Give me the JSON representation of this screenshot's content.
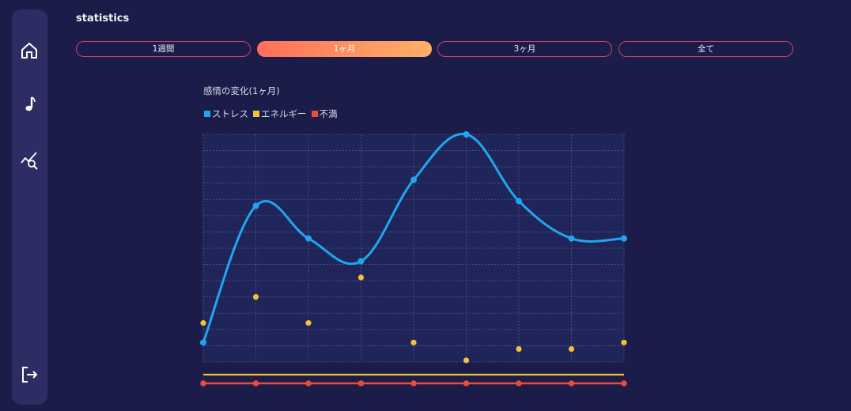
{
  "page": {
    "title": "statistics"
  },
  "sidebar": {
    "items": [
      {
        "icon": "home-icon"
      },
      {
        "icon": "music-note-icon"
      },
      {
        "icon": "chart-search-icon"
      },
      {
        "icon": "logout-icon"
      }
    ]
  },
  "tabs": [
    {
      "label": "1週間",
      "active": false
    },
    {
      "label": "1ヶ月",
      "active": true
    },
    {
      "label": "3ヶ月",
      "active": false
    },
    {
      "label": "全て",
      "active": false
    }
  ],
  "colors": {
    "background": "#1b1c4a",
    "sidebar": "#2d2d63",
    "stress": "#1ea7ee",
    "energy": "#f4c236",
    "dissatisfaction": "#e94b3c",
    "tab_border": "#c2456a",
    "tab_active_start": "#ff6f5a",
    "tab_active_end": "#ffb068"
  },
  "chart_data": {
    "type": "line",
    "title": "感情の変化(1ヶ月)",
    "legend_position": "top-left",
    "grid": true,
    "x": [
      1,
      2,
      3,
      4,
      5,
      6,
      7,
      8,
      9
    ],
    "ylim": [
      0,
      14
    ],
    "series": [
      {
        "name": "ストレス",
        "color": "#1ea7ee",
        "style": "smooth-line",
        "values": [
          1.2,
          9.6,
          7.6,
          6.2,
          11.2,
          14.0,
          9.9,
          7.6,
          7.6
        ]
      },
      {
        "name": "エネルギー",
        "color": "#f4c236",
        "style": "dots",
        "values": [
          2.4,
          4.0,
          2.4,
          5.2,
          1.2,
          0.1,
          0.8,
          0.8,
          1.2
        ]
      },
      {
        "name": "不満",
        "color": "#e94b3c",
        "style": "line-dots",
        "values": [
          0,
          0,
          0,
          0,
          0,
          0,
          0,
          0,
          0
        ]
      }
    ]
  }
}
